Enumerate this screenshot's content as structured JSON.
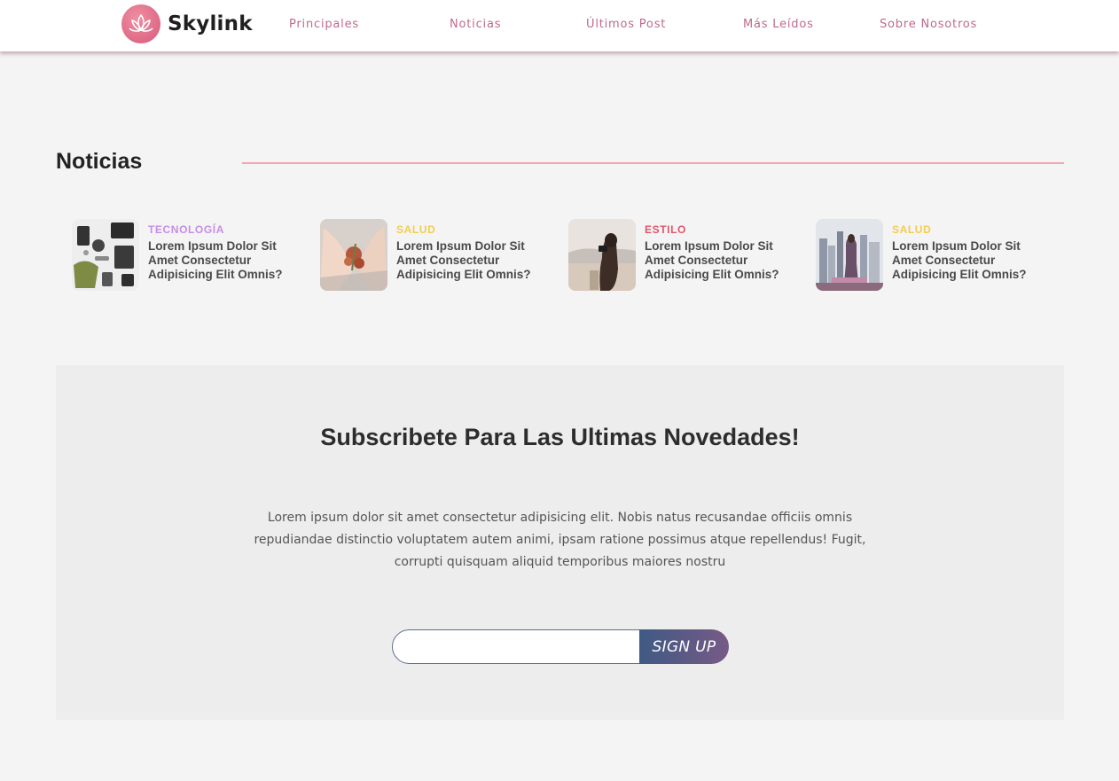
{
  "brand": {
    "name": "Skylink",
    "accent": "#d8587a"
  },
  "nav": {
    "items": [
      {
        "label": "Principales"
      },
      {
        "label": "Noticias"
      },
      {
        "label": "Últimos Post"
      },
      {
        "label": "Más Leídos"
      },
      {
        "label": "Sobre Nosotros"
      }
    ],
    "link_color": "#c06a8c"
  },
  "news": {
    "title": "Noticias",
    "rule_color": "#f2a7b1",
    "cards": [
      {
        "category": "TECNOLOGÍA",
        "category_color": "#c58ee6",
        "headline": "Lorem Ipsum Dolor Sit Amet Consectetur Adipisicing Elit Omnis?",
        "image": "flatlay-gadgets"
      },
      {
        "category": "SALUD",
        "category_color": "#f2cd4f",
        "headline": "Lorem Ipsum Dolor Sit Amet Consectetur Adipisicing Elit Omnis?",
        "image": "hands-flowers"
      },
      {
        "category": "ESTILO",
        "category_color": "#e0566a",
        "headline": "Lorem Ipsum Dolor Sit Amet Consectetur Adipisicing Elit Omnis?",
        "image": "woman-camera-beach"
      },
      {
        "category": "SALUD",
        "category_color": "#f2cd4f",
        "headline": "Lorem Ipsum Dolor Sit Amet Consectetur Adipisicing Elit Omnis?",
        "image": "woman-city-skyline"
      }
    ]
  },
  "subscribe": {
    "title": "Subscribete Para Las Ultimas Novedades!",
    "text": "Lorem ipsum dolor sit amet consectetur adipisicing elit. Nobis natus recusandae officiis omnis repudiandae distinctio voluptatem autem animi, ipsam ratione possimus atque repellendus! Fugit, corrupti quisquam aliquid temporibus maiores nostru",
    "email_value": "",
    "email_placeholder": "",
    "button_label": "SIGN UP"
  }
}
